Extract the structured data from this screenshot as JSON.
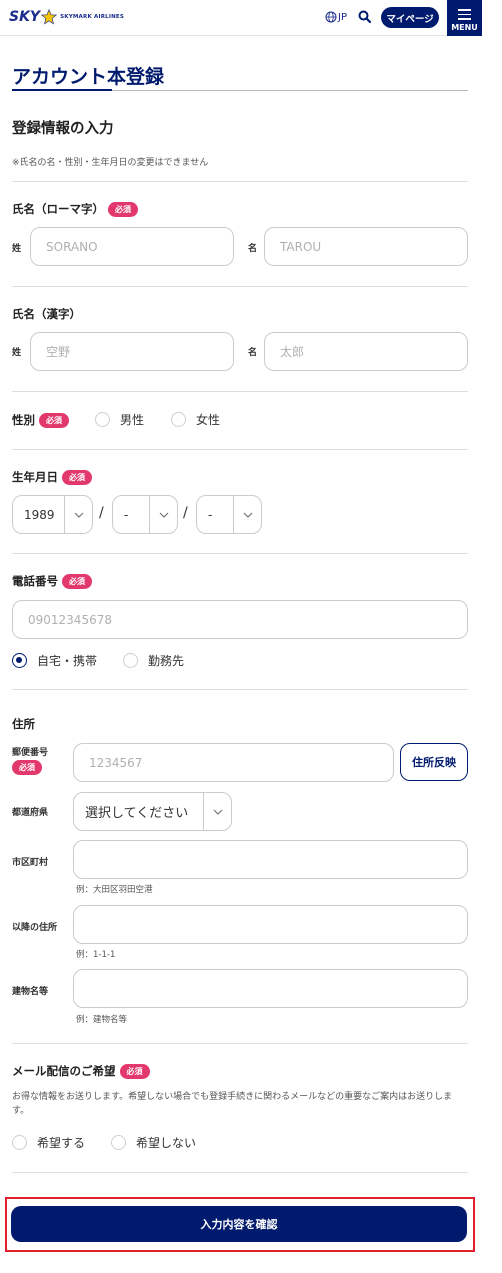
{
  "header": {
    "logo_main": "SKY",
    "logo_sub": "SKYMARK AIRLINES",
    "lang": "JP",
    "mypage": "マイページ",
    "menu": "MENU"
  },
  "page": {
    "title": "アカウント本登録",
    "section": "登録情報の入力",
    "notice": "※氏名の名・性別・生年月日の変更はできません"
  },
  "required_badge": "必須",
  "name_roman": {
    "label": "氏名（ローマ字）",
    "last_label": "姓",
    "first_label": "名",
    "last_placeholder": "SORANO",
    "first_placeholder": "TAROU"
  },
  "name_kanji": {
    "label": "氏名（漢字）",
    "last_label": "姓",
    "first_label": "名",
    "last_placeholder": "空野",
    "first_placeholder": "太郎"
  },
  "gender": {
    "label": "性別",
    "options": [
      "男性",
      "女性"
    ]
  },
  "birthdate": {
    "label": "生年月日",
    "year": "1989",
    "month": "-",
    "day": "-",
    "separator": "/"
  },
  "phone": {
    "label": "電話番号",
    "placeholder": "09012345678",
    "options": [
      "自宅・携帯",
      "勤務先"
    ],
    "selected": "自宅・携帯"
  },
  "address": {
    "label": "住所",
    "postal_label": "郵便番号",
    "postal_placeholder": "1234567",
    "reflect_button": "住所反映",
    "prefecture_label": "都道府県",
    "prefecture_value": "選択してください",
    "city_label": "市区町村",
    "city_hint": "例：大田区羽田空港",
    "street_label": "以降の住所",
    "street_hint": "例：1-1-1",
    "building_label": "建物名等",
    "building_hint": "例：建物名等"
  },
  "mail": {
    "label": "メール配信のご希望",
    "description": "お得な情報をお送りします。希望しない場合でも登録手続きに関わるメールなどの重要なご案内はお送りします。",
    "options": [
      "希望する",
      "希望しない"
    ]
  },
  "submit": "入力内容を確認",
  "colors": {
    "brand_navy": "#001a6e",
    "required_pink": "#e3386b",
    "highlight_red": "#e0202b"
  }
}
